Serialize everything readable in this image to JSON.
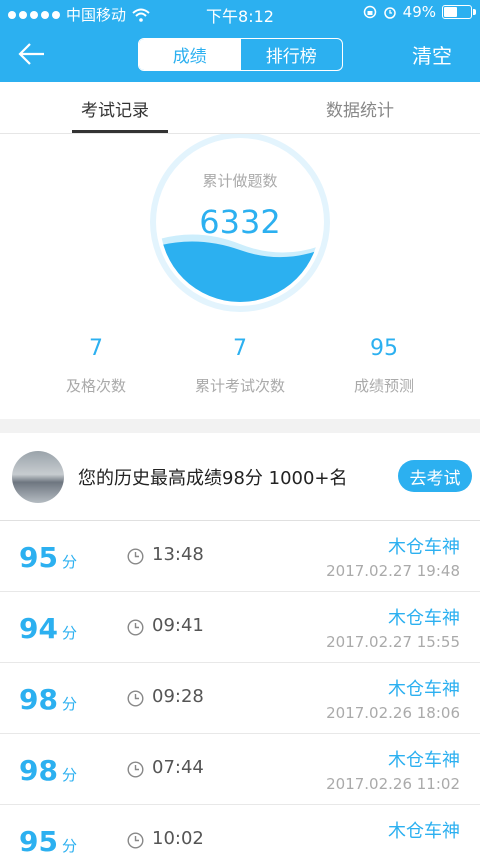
{
  "status_bar": {
    "carrier": "中国移动",
    "time": "下午8:12",
    "battery": "49%"
  },
  "nav": {
    "segment_active": "成绩",
    "segment_inactive": "排行榜",
    "clear_label": "清空"
  },
  "tabs": {
    "records": "考试记录",
    "statistics": "数据统计"
  },
  "summary": {
    "ring_label": "累计做题数",
    "ring_value": "6332",
    "stats": [
      {
        "value": "7",
        "label": "及格次数"
      },
      {
        "value": "7",
        "label": "累计考试次数"
      },
      {
        "value": "95",
        "label": "成绩预测"
      }
    ]
  },
  "best": {
    "text": "您的历史最高成绩98分 1000+名",
    "button": "去考试"
  },
  "records": [
    {
      "score": "95",
      "unit": "分",
      "duration": "13:48",
      "name": "木仓车神",
      "date": "2017.02.27 19:48"
    },
    {
      "score": "94",
      "unit": "分",
      "duration": "09:41",
      "name": "木仓车神",
      "date": "2017.02.27 15:55"
    },
    {
      "score": "98",
      "unit": "分",
      "duration": "09:28",
      "name": "木仓车神",
      "date": "2017.02.26 18:06"
    },
    {
      "score": "98",
      "unit": "分",
      "duration": "07:44",
      "name": "木仓车神",
      "date": "2017.02.26 11:02"
    },
    {
      "score": "95",
      "unit": "分",
      "duration": "10:02",
      "name": "木仓车神",
      "date": ""
    }
  ],
  "colors": {
    "accent": "#2cb0f0",
    "muted": "#aaaaaa",
    "divider": "#f2f2f2"
  },
  "icons": [
    "back-arrow-icon",
    "wifi-icon",
    "lock-rotation-icon",
    "alarm-icon",
    "battery-icon",
    "clock-icon"
  ]
}
